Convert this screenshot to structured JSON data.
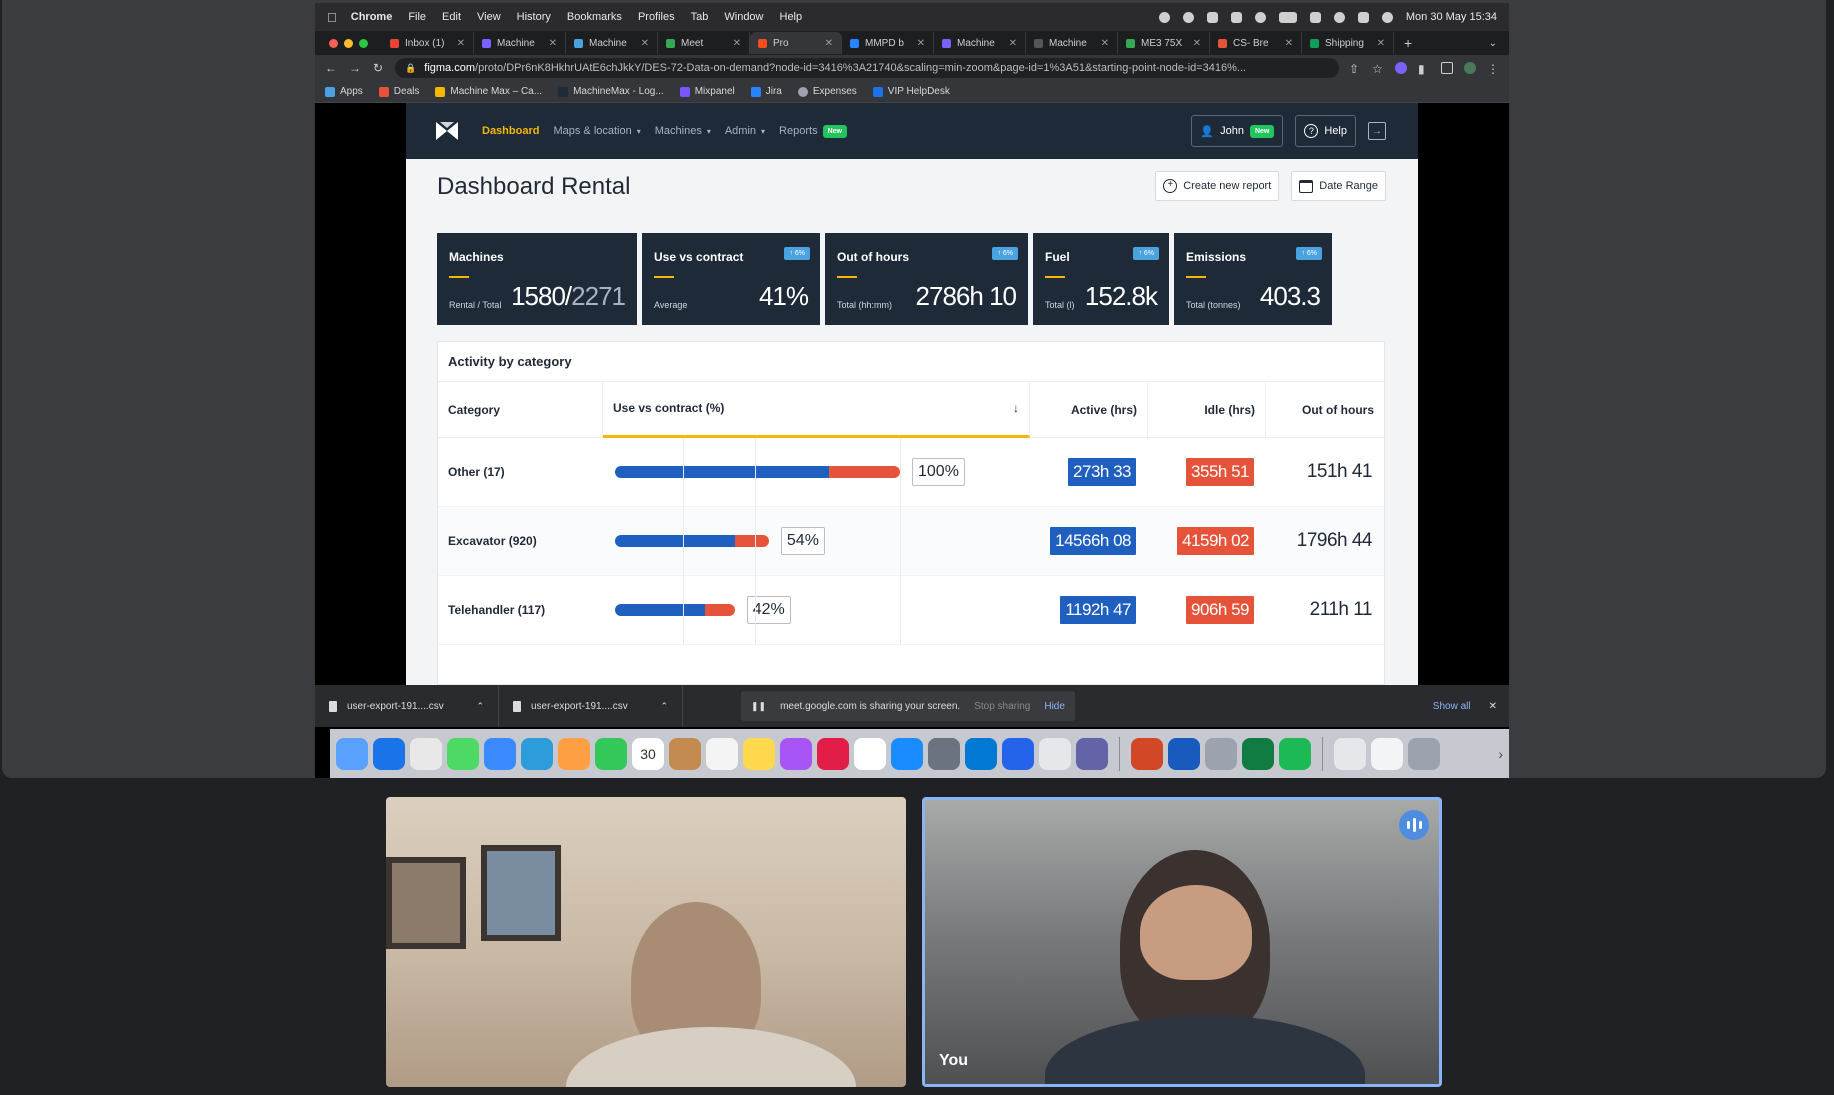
{
  "mac_menubar": {
    "app": "Chrome",
    "items": [
      "File",
      "Edit",
      "View",
      "History",
      "Bookmarks",
      "Profiles",
      "Tab",
      "Window",
      "Help"
    ],
    "clock": "Mon 30 May  15:34"
  },
  "browser": {
    "tabs": [
      {
        "label": "Inbox (1)",
        "color": "#ea4335"
      },
      {
        "label": "Machine",
        "color": "#7b61ff"
      },
      {
        "label": "Machine",
        "color": "#4aa3df"
      },
      {
        "label": "Meet",
        "color": "#34a853"
      },
      {
        "label": "Pro",
        "color": "#f24e1e",
        "active": true
      },
      {
        "label": "MMPD b",
        "color": "#2684ff"
      },
      {
        "label": "Machine",
        "color": "#7b61ff"
      },
      {
        "label": "Machine",
        "color": "#555555"
      },
      {
        "label": "ME3 75X",
        "color": "#34a853"
      },
      {
        "label": "CS- Bre",
        "color": "#e5533a"
      },
      {
        "label": "Shipping",
        "color": "#0f9d58"
      }
    ],
    "new_tab": "+",
    "url_host": "figma.com",
    "url_rest": "/proto/DPr6nK8HkhrUAtE6chJkkY/DES-72-Data-on-demand?node-id=3416%3A21740&scaling=min-zoom&page-id=1%3A51&starting-point-node-id=3416%...",
    "bookmarks": [
      "Apps",
      "Deals",
      "Machine Max – Ca...",
      "MachineMax - Log...",
      "Mixpanel",
      "Jira",
      "Expenses",
      "VIP HelpDesk"
    ]
  },
  "app": {
    "nav": {
      "items": [
        {
          "label": "Dashboard",
          "active": true
        },
        {
          "label": "Maps & location",
          "dropdown": true
        },
        {
          "label": "Machines",
          "dropdown": true
        },
        {
          "label": "Admin",
          "dropdown": true
        },
        {
          "label": "Reports",
          "badge": "New"
        }
      ],
      "user": "John",
      "user_badge": "New",
      "help": "Help"
    },
    "page_title": "Dashboard Rental",
    "actions": {
      "create": "Create new report",
      "date": "Date Range"
    },
    "kpis": [
      {
        "title": "Machines",
        "sub": "Rental / Total",
        "value_main": "1580/",
        "value_dim": "2271",
        "badge": ""
      },
      {
        "title": "Use vs contract",
        "sub": "Average",
        "value_main": "41%",
        "value_dim": "",
        "badge": "↑ 6%"
      },
      {
        "title": "Out of hours",
        "sub": "Total (hh:mm)",
        "value_main": "2786h 10",
        "value_dim": "",
        "badge": "↑ 6%"
      },
      {
        "title": "Fuel",
        "sub": "Total (l)",
        "value_main": "152.8k",
        "value_dim": "",
        "badge": "↑ 6%"
      },
      {
        "title": "Emissions",
        "sub": "Total (tonnes)",
        "value_main": "403.3",
        "value_dim": "",
        "badge": "↑ 6%"
      }
    ],
    "activity": {
      "title": "Activity by category",
      "columns": [
        "Category",
        "Use vs contract (%)",
        "Active (hrs)",
        "Idle (hrs)",
        "Out of hours"
      ],
      "sort_icon": "↓",
      "rows": [
        {
          "category": "Other (17)",
          "use_pct": 100,
          "active_share": 0.75,
          "pct_label": "100%",
          "active": "273h 33",
          "idle": "355h 51",
          "ooh": "151h 41"
        },
        {
          "category": "Excavator (920)",
          "use_pct": 54,
          "active_share": 0.78,
          "pct_label": "54%",
          "active": "14566h 08",
          "idle": "4159h 02",
          "ooh": "1796h 44"
        },
        {
          "category": "Telehandler (117)",
          "use_pct": 42,
          "active_share": 0.75,
          "pct_label": "42%",
          "active": "1192h 47",
          "idle": "906h 59",
          "ooh": "211h 11"
        }
      ]
    }
  },
  "downloads": {
    "files": [
      "user-export-191....csv",
      "user-export-191....csv"
    ],
    "share_text": "meet.google.com is sharing your screen.",
    "stop": "Stop sharing",
    "hide": "Hide",
    "show_all": "Show all",
    "close": "✕"
  },
  "dock": {
    "apps": [
      "#5aa0ff",
      "#1a73e8",
      "#e8e8e8",
      "#4cd964",
      "#3b8bff",
      "#2d9cdb",
      "#ff9f43",
      "#34c759",
      "#ffffff",
      "#c38b50",
      "#f4f4f4",
      "#ffd84d",
      "#a855f7",
      "#e11d48",
      "#ffffff",
      "#1a8cff",
      "#6b7280",
      "#0078d4",
      "#2563eb",
      "#e5e7eb",
      "#6264a7"
    ],
    "apps_after": [
      "#d24726",
      "#185abd",
      "#9ca3af",
      "#107c41",
      "#1db954"
    ],
    "calendar_day": "30"
  },
  "meet": {
    "you_label": "You"
  }
}
